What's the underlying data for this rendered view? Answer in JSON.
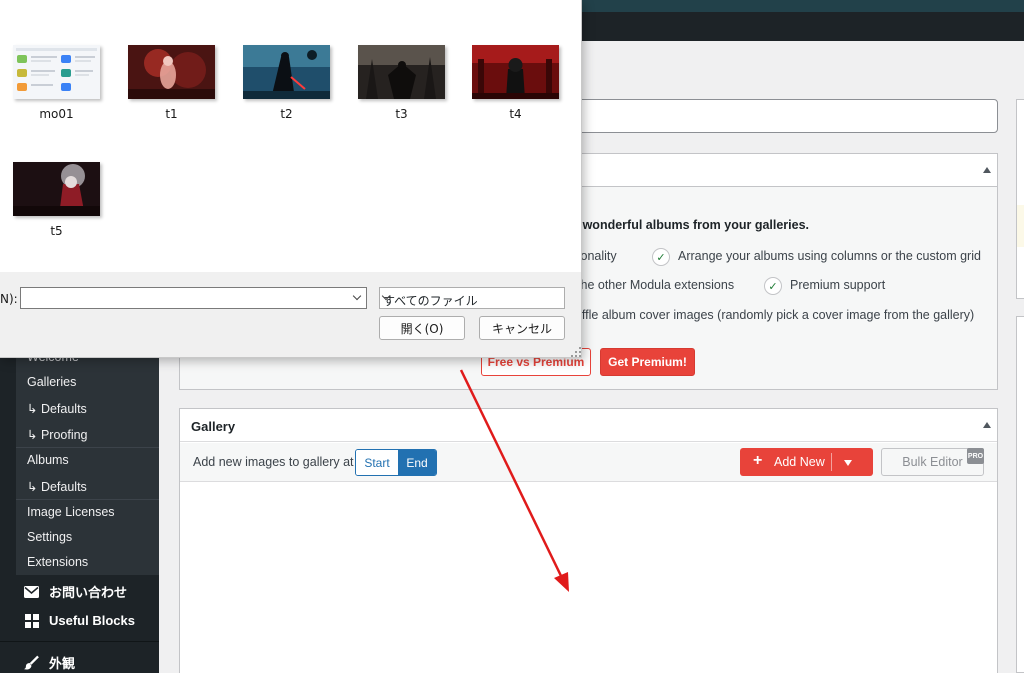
{
  "sidebar": {
    "submenu": [
      {
        "label": "Welcome"
      },
      {
        "label": "Galleries"
      },
      {
        "label": "↳ Defaults"
      },
      {
        "label": "↳ Proofing"
      },
      {
        "label": "Albums"
      },
      {
        "label": "↳ Defaults"
      },
      {
        "label": "Image Licenses"
      },
      {
        "label": "Settings"
      },
      {
        "label": "Extensions"
      }
    ],
    "menu": [
      {
        "label": "お問い合わせ",
        "icon": "envelope-icon"
      },
      {
        "label": "Useful Blocks",
        "icon": "grid-icon"
      },
      {
        "label": "外観",
        "icon": "paintbrush-icon"
      }
    ]
  },
  "upsell": {
    "heading": "te wonderful albums from your galleries.",
    "features": [
      "ctionality",
      "Arrange your albums using columns or the custom grid",
      "ll the other Modula extensions",
      "Premium support",
      "huffle album cover images (randomly pick a cover image from the gallery)"
    ],
    "free_vs_premium": "Free vs Premium",
    "get_premium": "Get Premium!"
  },
  "gallery": {
    "title": "Gallery",
    "add_at_label": "Add new images to gallery at",
    "start": "Start",
    "end": "End",
    "add_new": "Add New",
    "bulk_editor": "Bulk Editor",
    "pro_badge": "PRO"
  },
  "dialog": {
    "files": [
      {
        "name": "mo01"
      },
      {
        "name": "t1"
      },
      {
        "name": "t2"
      },
      {
        "name": "t3"
      },
      {
        "name": "t4"
      },
      {
        "name": "t5"
      }
    ],
    "filename_label": "N):",
    "filename_value": "",
    "filetype": "すべてのファイル",
    "open": "開く(O)",
    "cancel": "キャンセル"
  },
  "colors": {
    "accent_red": "#e8433a",
    "wp_blue": "#2271b1",
    "sidebar_dark": "#1d2327",
    "arrow_red": "#e01b1b"
  }
}
